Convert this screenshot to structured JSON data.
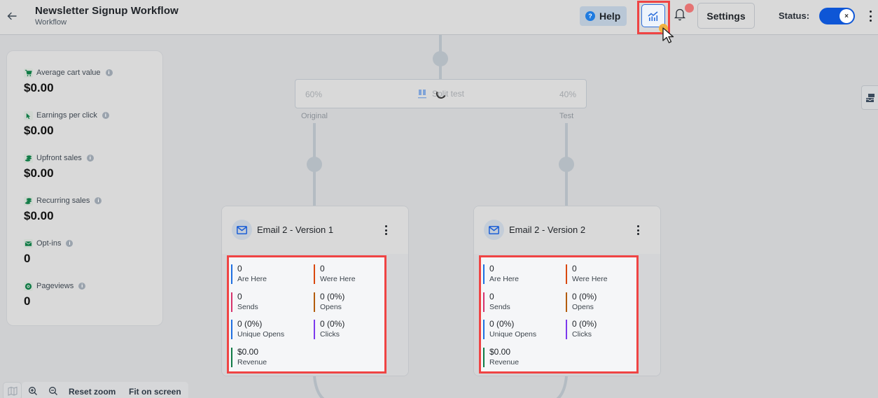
{
  "header": {
    "title": "Newsletter Signup Workflow",
    "subtitle": "Workflow",
    "help_label": "Help",
    "settings_label": "Settings",
    "status_label": "Status:",
    "status_toggle_on": true,
    "status_knob_glyph": "×",
    "help_glyph": "?"
  },
  "stats_panel": {
    "items": [
      {
        "label": "Average cart value",
        "value": "$0.00",
        "icon": "cart-icon"
      },
      {
        "label": "Earnings per click",
        "value": "$0.00",
        "icon": "cursor-click-icon"
      },
      {
        "label": "Upfront sales",
        "value": "$0.00",
        "icon": "coins-icon"
      },
      {
        "label": "Recurring sales",
        "value": "$0.00",
        "icon": "coins-icon"
      },
      {
        "label": "Opt-ins",
        "value": "0",
        "icon": "envelope-icon"
      },
      {
        "label": "Pageviews",
        "value": "0",
        "icon": "eye-icon"
      }
    ],
    "info_glyph": "i"
  },
  "split_test": {
    "label": "Split test",
    "left_percent": "60%",
    "right_percent": "40%",
    "left_branch": "Original",
    "right_branch": "Test"
  },
  "cards": [
    {
      "title": "Email 2 - Version 1",
      "metrics": [
        {
          "value": "0",
          "label": "Are Here",
          "color": "#1f6fe0"
        },
        {
          "value": "0",
          "label": "Were Here",
          "color": "#d9480f"
        },
        {
          "value": "0",
          "label": "Sends",
          "color": "#d6336c"
        },
        {
          "value": "0 (0%)",
          "label": "Opens",
          "color": "#b35c0c"
        },
        {
          "value": "0 (0%)",
          "label": "Unique Opens",
          "color": "#1f6fe0"
        },
        {
          "value": "0 (0%)",
          "label": "Clicks",
          "color": "#7c3aed"
        },
        {
          "value": "$0.00",
          "label": "Revenue",
          "color": "#0f7a45"
        }
      ]
    },
    {
      "title": "Email 2 - Version 2",
      "metrics": [
        {
          "value": "0",
          "label": "Are Here",
          "color": "#1f6fe0"
        },
        {
          "value": "0",
          "label": "Were Here",
          "color": "#d9480f"
        },
        {
          "value": "0",
          "label": "Sends",
          "color": "#d6336c"
        },
        {
          "value": "0 (0%)",
          "label": "Opens",
          "color": "#b35c0c"
        },
        {
          "value": "0 (0%)",
          "label": "Unique Opens",
          "color": "#1f6fe0"
        },
        {
          "value": "0 (0%)",
          "label": "Clicks",
          "color": "#7c3aed"
        },
        {
          "value": "$0.00",
          "label": "Revenue",
          "color": "#0f7a45"
        }
      ]
    }
  ],
  "zoom_toolbar": {
    "reset_label": "Reset zoom",
    "fit_label": "Fit on screen"
  },
  "colors": {
    "accent": "#0e56d6",
    "highlight": "#ef4444",
    "stat_icon_green": "#0f7a45"
  }
}
